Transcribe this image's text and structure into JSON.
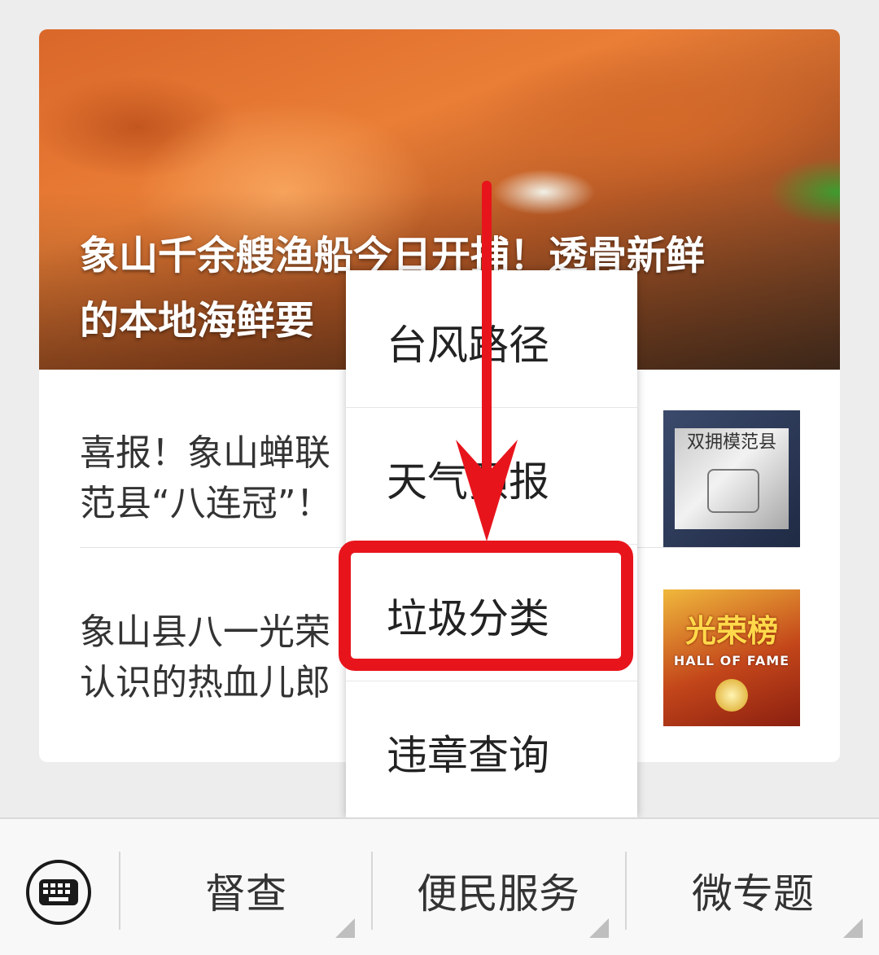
{
  "feed": {
    "hero": {
      "title": "象山千余艘渔船今日开捕！透骨新鲜\n的本地海鲜要"
    },
    "items": [
      {
        "text": "喜报！象山蝉联\n范县“八连冠”！",
        "thumb_text": "双拥模范县"
      },
      {
        "text": "象山县八一光荣\n认识的热血儿郎",
        "thumb_text": "光荣榜",
        "thumb_subtext": "HALL OF FAME"
      }
    ]
  },
  "popup_menu": {
    "items": [
      {
        "label": "台风路径"
      },
      {
        "label": "天气预报"
      },
      {
        "label": "垃圾分类"
      },
      {
        "label": "违章查询"
      }
    ],
    "highlighted_index": 2,
    "annotation_color": "#e8141c"
  },
  "bottom_bar": {
    "keyboard_icon": "keyboard-icon",
    "tabs": [
      {
        "label": "督查"
      },
      {
        "label": "便民服务"
      },
      {
        "label": "微专题"
      }
    ]
  }
}
